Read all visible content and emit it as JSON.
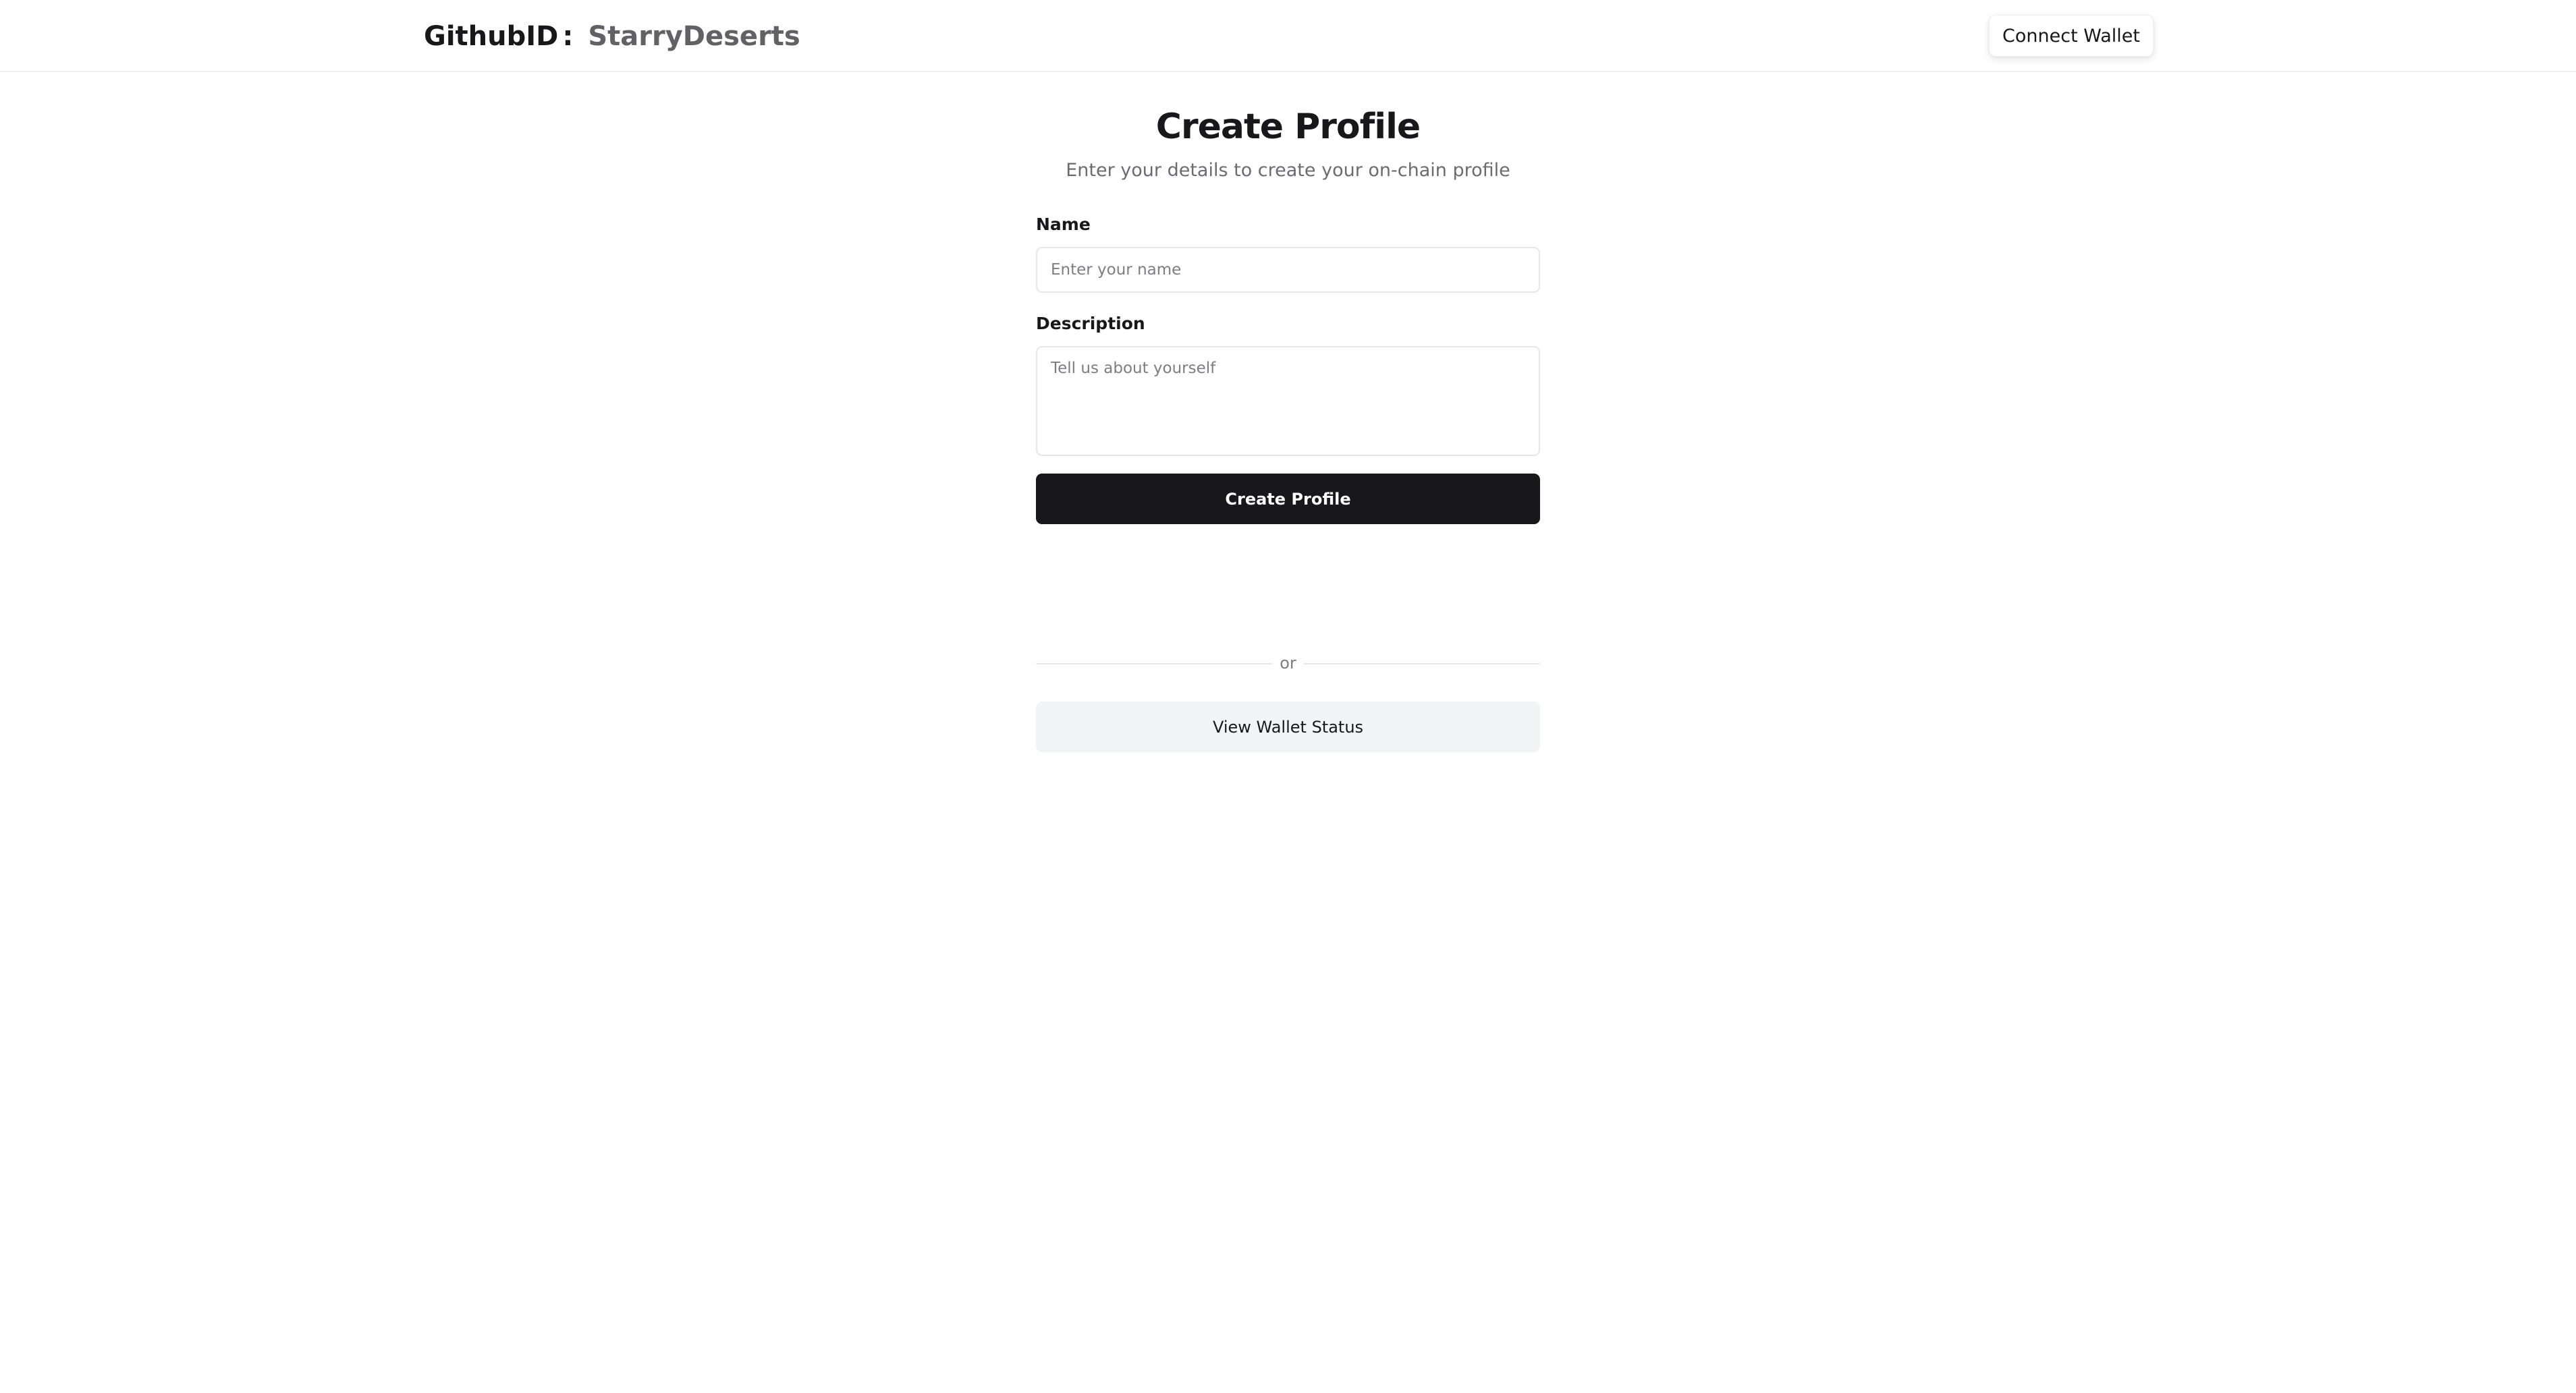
{
  "header": {
    "brand_label": "GithubID",
    "brand_separator": ":",
    "username": "StarryDeserts",
    "connect_wallet_label": "Connect Wallet"
  },
  "form": {
    "title": "Create Profile",
    "subtitle": "Enter your details to create your on-chain profile",
    "name_label": "Name",
    "name_placeholder": "Enter your name",
    "name_value": "",
    "description_label": "Description",
    "description_placeholder": "Tell us about yourself",
    "description_value": "",
    "submit_label": "Create Profile",
    "divider_text": "or",
    "wallet_status_label": "View Wallet Status"
  },
  "colors": {
    "primary_button": "#18181b",
    "secondary_button": "#f3f4f6",
    "username_text": "#616166"
  }
}
